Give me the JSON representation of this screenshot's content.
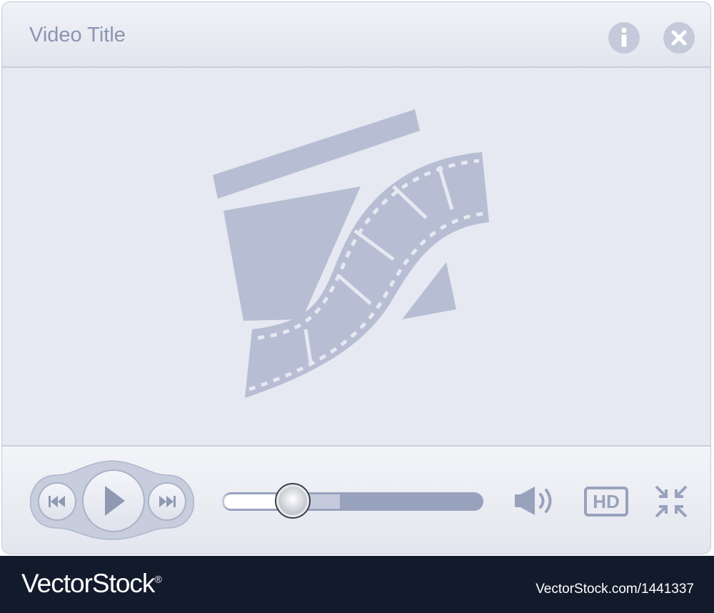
{
  "window": {
    "title": "Video Title",
    "info_icon": "info-icon",
    "close_icon": "close-icon"
  },
  "viewport": {
    "placeholder_icon": "clapperboard-film-icon"
  },
  "controls": {
    "prev_icon": "skip-back-icon",
    "play_icon": "play-icon",
    "next_icon": "skip-forward-icon",
    "seek_progress": 0.27,
    "seek_buffered": 0.45,
    "volume_icon": "volume-icon",
    "hd_label": "HD",
    "exit_fullscreen_icon": "exit-fullscreen-icon"
  },
  "footer": {
    "brand": "VectorStock",
    "registered": "®",
    "stock_id": "VectorStock.com/1441337"
  },
  "colors": {
    "accent": "#8a95b1",
    "icon": "#b7bed3",
    "frame": "#c3c8d8",
    "footer_bg": "#121b2b"
  }
}
